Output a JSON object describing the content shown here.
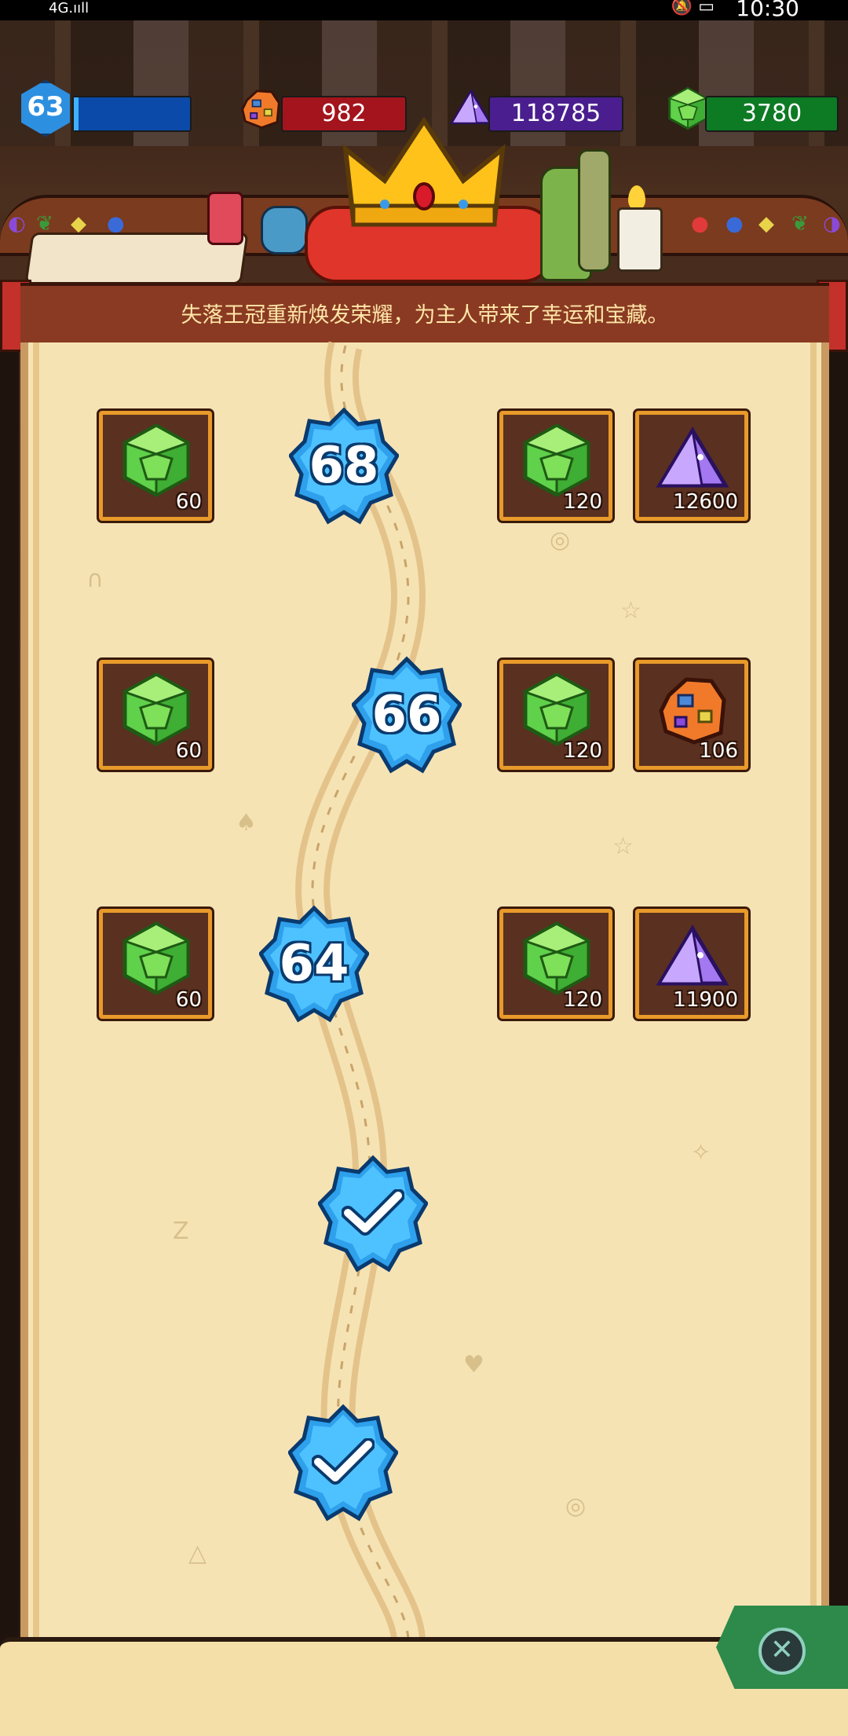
{
  "status_bar": {
    "time": "10:30",
    "signal": "4G.ııll",
    "icons": "🔕 ▭"
  },
  "hud": {
    "level": "63",
    "xp_fraction": 0.04,
    "ore_count": "982",
    "crystal_count": "118785",
    "gem_count": "3780",
    "colors": {
      "xp": "#0b4aa8",
      "ore": "#a3141c",
      "crystal": "#4a1e8e",
      "gem": "#0d7a24"
    }
  },
  "banner": {
    "text": "失落王冠重新焕发荣耀，为主人带来了幸运和宝藏。"
  },
  "levels": [
    {
      "label": "68",
      "state": "locked",
      "free_reward": {
        "icon": "green-gem-icon",
        "amount": "60"
      },
      "premium_rewards": [
        {
          "icon": "green-gem-icon",
          "amount": "120"
        },
        {
          "icon": "purple-crystal-icon",
          "amount": "12600"
        }
      ]
    },
    {
      "label": "66",
      "state": "locked",
      "free_reward": {
        "icon": "green-gem-icon",
        "amount": "60"
      },
      "premium_rewards": [
        {
          "icon": "green-gem-icon",
          "amount": "120"
        },
        {
          "icon": "ore-rock-icon",
          "amount": "106"
        }
      ]
    },
    {
      "label": "64",
      "state": "locked",
      "free_reward": {
        "icon": "green-gem-icon",
        "amount": "60"
      },
      "premium_rewards": [
        {
          "icon": "green-gem-icon",
          "amount": "120"
        },
        {
          "icon": "purple-crystal-icon",
          "amount": "11900"
        }
      ]
    },
    {
      "label": "",
      "state": "completed"
    },
    {
      "label": "",
      "state": "completed"
    }
  ],
  "close": {
    "icon": "close-icon",
    "glyph": "✕"
  }
}
